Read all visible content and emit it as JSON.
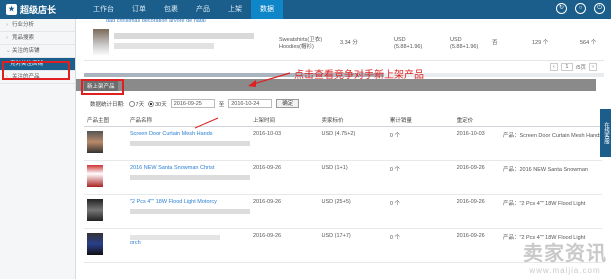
{
  "app": {
    "title": "超级店长"
  },
  "nav": [
    "工作台",
    "订单",
    "包裹",
    "产品",
    "上架",
    "数据"
  ],
  "nav_active": 5,
  "sidebar": {
    "items": [
      {
        "label": "行业分析"
      },
      {
        "label": "竞品搜索"
      },
      {
        "label": "关注的店铺"
      },
      {
        "label": "竞对关注店铺"
      },
      {
        "label": "关注的产品"
      }
    ]
  },
  "top_row": {
    "prev_title": "dad christmas decoration arvore de natal",
    "category": "Sweatshirts(卫衣)",
    "category2": "Hoodies(帽衫)",
    "price": "3.34 分",
    "usd1": "USD",
    "usd1_range": "(5.88+1.96)",
    "usd2": "USD",
    "usd2_range": "(5.88+1.96)",
    "status": "否",
    "count1": "129 个",
    "count2": "564 个"
  },
  "pager": {
    "page": "1",
    "total": "/5页"
  },
  "tab": {
    "label": "新上架产品"
  },
  "annotation": "点击查看竞争对手新上架产品",
  "filter": {
    "label": "数据统计日期:",
    "opt7": "7天",
    "opt30": "30天",
    "date_from": "2016-09-25",
    "date_sep": "至",
    "date_to": "2016-10-24",
    "confirm": "确定"
  },
  "table": {
    "headers": [
      "产品主图",
      "产品名称",
      "上架时间",
      "卖家标价",
      "累计销量",
      "重定价",
      ""
    ],
    "rows": [
      {
        "name": "Screen Door Curtain Mesh Hands",
        "date": "2016-10-03",
        "price": "USD (4.75+2)",
        "sales": "0 个",
        "redate": "2016-10-03",
        "cat": "产品：Screen Door Curtain Mesh Hands"
      },
      {
        "name": "2016 NEW Santa Snowman Christ",
        "date": "2016-09-26",
        "price": "USD (1+1)",
        "sales": "0 个",
        "redate": "2016-09-26",
        "cat": "产品：2016 NEW Santa Snowman"
      },
      {
        "name": "\"2 Pcs 4\"\" 18W Flood Light Motorcy",
        "date": "2016-09-26",
        "price": "USD (25+5)",
        "sales": "0 个",
        "redate": "2016-09-26",
        "cat": "产品：\"2 Pcs 4\"\" 18W Flood Light"
      },
      {
        "name": "orch",
        "date": "2016-09-26",
        "price": "USD (17+7)",
        "sales": "0 个",
        "redate": "2016-09-26",
        "cat": "产品：\"2 Pcs 4\"\" 18W Flood Light"
      }
    ]
  },
  "right_tab": "在线客服",
  "watermark": {
    "text": "卖家资讯",
    "url": "www.maijia.com"
  },
  "colors": {
    "topbar": "#1b5e8c",
    "accent": "#0f86c8",
    "highlight": "#e02020",
    "link": "#2a7fd4"
  }
}
